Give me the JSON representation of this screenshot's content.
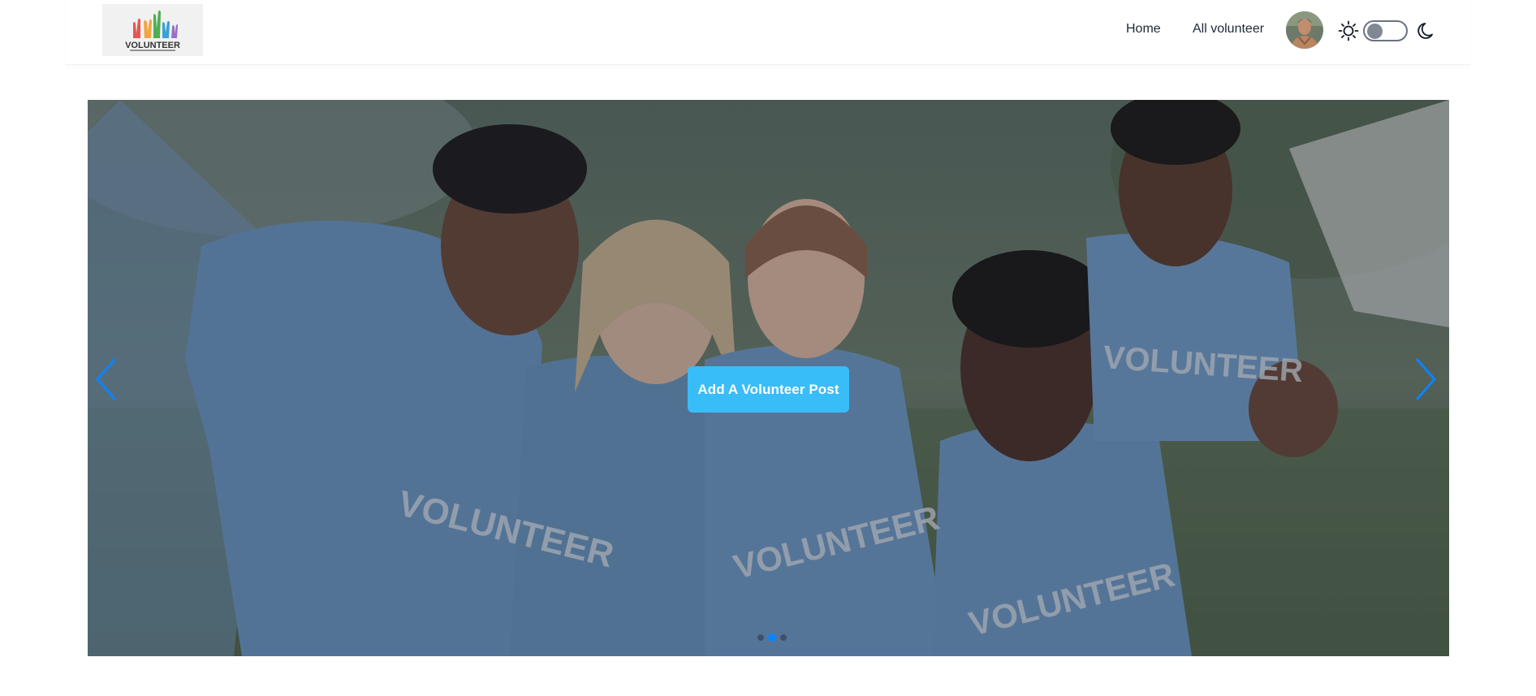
{
  "brand": {
    "logo_text": "VOLUNTEER"
  },
  "nav": {
    "items": [
      {
        "label": "Home"
      },
      {
        "label": "All volunteer"
      }
    ],
    "theme_toggle": {
      "state": "light"
    }
  },
  "hero": {
    "shirt_text": "VOLUNTEER",
    "cta_label": "Add A Volunteer Post",
    "slide_count": 3,
    "active_slide": 2
  },
  "colors": {
    "accent": "#38bdf8",
    "arrow": "#0a84ff",
    "shirt": "#6b93bd"
  }
}
